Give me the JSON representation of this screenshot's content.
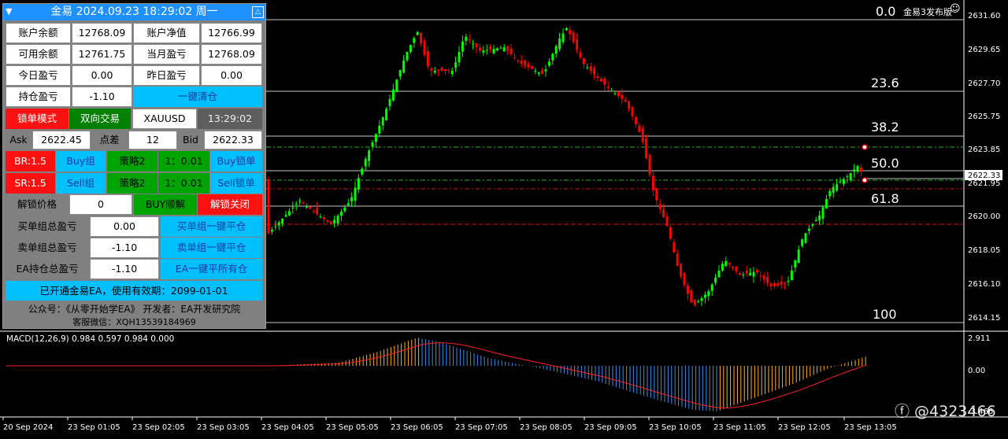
{
  "panel": {
    "title": "金易 2024.09.23 18:29:02 周一",
    "rows": {
      "balance_label": "账户余额",
      "balance_value": "12768.09",
      "equity_label": "账户净值",
      "equity_value": "12766.99",
      "free_label": "可用余额",
      "free_value": "12761.75",
      "month_label": "当月盈亏",
      "month_value": "12768.09",
      "today_label": "今日盈亏",
      "today_value": "0.00",
      "yesterday_label": "昨日盈亏",
      "yesterday_value": "0.00",
      "position_label": "持仓盈亏",
      "position_value": "-1.10",
      "close_all_button": "一键清仓",
      "lock_mode_button": "锁单模式",
      "two_way_button": "双向交易",
      "symbol": "XAUUSD",
      "server_time": "13:29:02",
      "ask_label": "Ask",
      "ask_value": "2622.45",
      "spread_label": "点差",
      "spread_value": "12",
      "bid_label": "Bid",
      "bid_value": "2622.33",
      "br_button": "BR:1.5",
      "buy_group_button": "Buy组",
      "strategy_buy": "策略2",
      "ratio_buy": "1：0.01",
      "buy_lock_button": "Buy锁单",
      "sr_button": "SR:1.5",
      "sell_group_button": "Sell组",
      "strategy_sell": "策略2",
      "ratio_sell": "1：0.01",
      "sell_lock_button": "Sell锁单",
      "unlock_price_label": "解锁价格",
      "unlock_price_value": "0",
      "buy_unlock_button": "BUY顺解",
      "unlock_close_button": "解锁关闭",
      "buy_total_label": "买单组总盈亏",
      "buy_total_value": "0.00",
      "buy_close_button": "买单组一键平仓",
      "sell_total_label": "卖单组总盈亏",
      "sell_total_value": "-1.10",
      "sell_close_button": "卖单组一键平仓",
      "ea_total_label": "EA持仓总盈亏",
      "ea_total_value": "-1.10",
      "ea_close_button": "EA一键平所有仓",
      "license_text": "已开通金易EA，使用有效期：2099-01-01"
    },
    "footer_line1": "公众号：《从零开始学EA》 开发者：EA开发研究院",
    "footer_line2": "客服微信：XQH13539184969"
  },
  "chart": {
    "corner_label": "金易3发布版",
    "current_price_tag": "2622.33",
    "price_axis": [
      "2631.60",
      "2629.65",
      "2627.70",
      "2625.75",
      "2623.85",
      "2621.95",
      "2620.00",
      "2618.05",
      "2616.10",
      "2614.15"
    ],
    "fib_levels": [
      "0.0",
      "23.6",
      "38.2",
      "50.0",
      "61.8",
      "100"
    ],
    "time_axis": [
      "20 Sep 2024",
      "23 Sep 01:05",
      "23 Sep 02:05",
      "23 Sep 03:05",
      "23 Sep 04:05",
      "23 Sep 05:05",
      "23 Sep 06:05",
      "23 Sep 07:05",
      "23 Sep 08:05",
      "23 Sep 09:05",
      "23 Sep 10:05",
      "23 Sep 11:05",
      "23 Sep 12:05",
      "23 Sep 13:05"
    ],
    "macd_label": "MACD(12,26,9) 0.984 0.597 0.984 0.000",
    "macd_axis": [
      "2.911",
      "0.00",
      "-3.466"
    ],
    "bull_color": "#00ff00",
    "bear_color": "#ff0000"
  },
  "watermark": "@4323466"
}
